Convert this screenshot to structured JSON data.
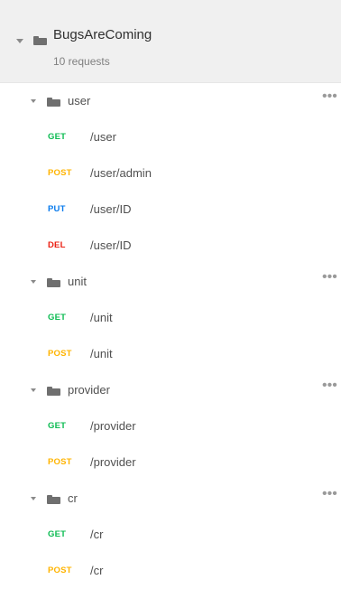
{
  "collection": {
    "name": "BugsAreComing",
    "count_label": "10 requests",
    "icon": "folder-icon",
    "caret_icon": "caret-down-icon"
  },
  "method_colors": {
    "GET": "#0cbb52",
    "POST": "#ffb400",
    "PUT": "#097bed",
    "DEL": "#eb2013"
  },
  "more_glyph": "•••",
  "folders": [
    {
      "name": "user",
      "requests": [
        {
          "method": "GET",
          "path": "/user"
        },
        {
          "method": "POST",
          "path": "/user/admin"
        },
        {
          "method": "PUT",
          "path": "/user/ID"
        },
        {
          "method": "DEL",
          "path": "/user/ID"
        }
      ]
    },
    {
      "name": "unit",
      "requests": [
        {
          "method": "GET",
          "path": "/unit"
        },
        {
          "method": "POST",
          "path": "/unit"
        }
      ]
    },
    {
      "name": "provider",
      "requests": [
        {
          "method": "GET",
          "path": "/provider"
        },
        {
          "method": "POST",
          "path": "/provider"
        }
      ]
    },
    {
      "name": "cr",
      "requests": [
        {
          "method": "GET",
          "path": "/cr"
        },
        {
          "method": "POST",
          "path": "/cr"
        }
      ]
    }
  ]
}
